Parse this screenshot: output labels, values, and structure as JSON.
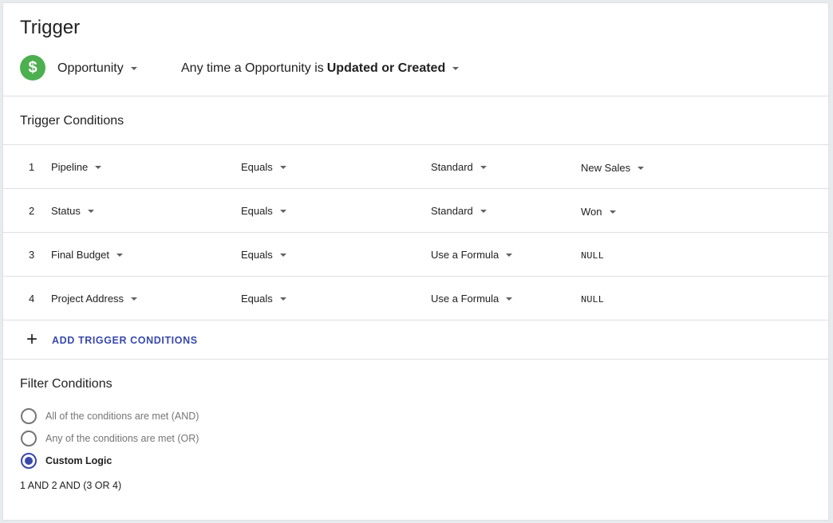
{
  "trigger": {
    "title": "Trigger",
    "object_icon_glyph": "$",
    "object_icon_color": "#4caf50",
    "object_label": "Opportunity",
    "event_prefix": "Any time a Opportunity is",
    "event_value": "Updated or Created"
  },
  "trigger_conditions": {
    "title": "Trigger Conditions",
    "rows": [
      {
        "num": "1",
        "field": "Pipeline",
        "operator": "Equals",
        "mode": "Standard",
        "value": "New Sales",
        "value_has_dropdown": true
      },
      {
        "num": "2",
        "field": "Status",
        "operator": "Equals",
        "mode": "Standard",
        "value": "Won",
        "value_has_dropdown": true
      },
      {
        "num": "3",
        "field": "Final Budget",
        "operator": "Equals",
        "mode": "Use a Formula",
        "value": "NULL",
        "value_has_dropdown": false
      },
      {
        "num": "4",
        "field": "Project Address",
        "operator": "Equals",
        "mode": "Use a Formula",
        "value": "NULL",
        "value_has_dropdown": false
      }
    ],
    "add_label": "ADD TRIGGER CONDITIONS"
  },
  "filter_conditions": {
    "title": "Filter Conditions",
    "options": [
      {
        "label": "All of the conditions are met (AND)",
        "selected": false
      },
      {
        "label": "Any of the conditions are met (OR)",
        "selected": false
      },
      {
        "label": "Custom Logic",
        "selected": true
      }
    ],
    "custom_logic": "1 AND 2 AND (3 OR 4)"
  },
  "colors": {
    "accent": "#3949ab",
    "divider": "#e0e0e0"
  }
}
